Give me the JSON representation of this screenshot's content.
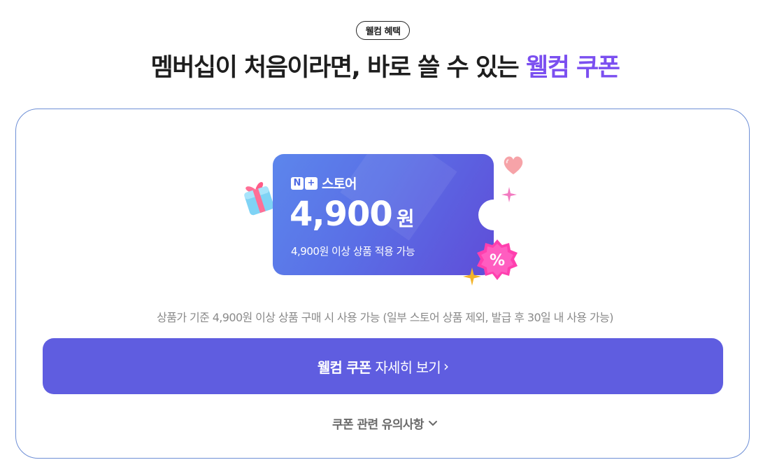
{
  "badge": "웰컴 혜택",
  "headline": {
    "prefix": "멤버십이 처음이라면, 바로 쓸 수 있는 ",
    "accent": "웰컴 쿠폰"
  },
  "coupon": {
    "logo": [
      "N",
      "+"
    ],
    "brand": "스토어",
    "amount": "4,900",
    "unit": "원",
    "condition": "4,900원 이상 상품 적용 가능",
    "percent_mark": "%"
  },
  "notice": "상품가 기준 4,900원 이상 상품 구매 시 사용 가능 (일부 스토어 상품 제외, 발급 후 30일 내 사용 가능)",
  "cta": {
    "bold": "웰컴 쿠폰",
    "rest": "자세히 보기",
    "chevron": "›"
  },
  "caution": {
    "label": "쿠폰 관련 유의사항",
    "chevron": "⌄"
  },
  "colors": {
    "accent": "#7b4ff0",
    "button": "#5f5de0",
    "card_border": "#6e8fd6"
  },
  "icons": [
    "gift-icon",
    "heart-icon",
    "sparkle-icon",
    "percent-badge-icon",
    "star-icon",
    "chevron-right-icon",
    "chevron-down-icon"
  ]
}
